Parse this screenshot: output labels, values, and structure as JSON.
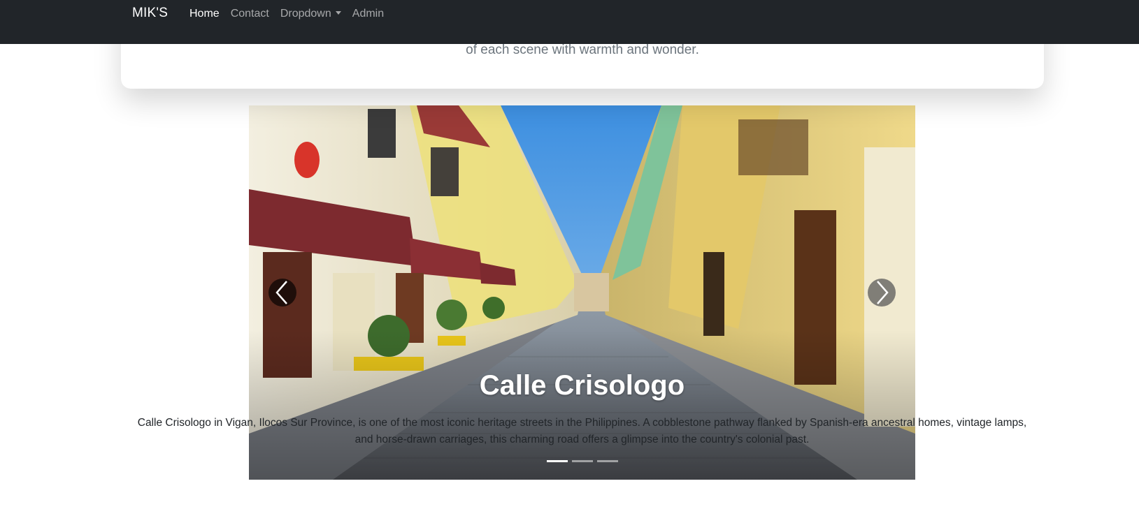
{
  "navbar": {
    "brand": "MIK'S",
    "links": [
      {
        "label": "Home"
      },
      {
        "label": "Contact"
      },
      {
        "label": "Dropdown"
      },
      {
        "label": "Admin"
      }
    ]
  },
  "hero": {
    "subtitle_fragment": "of each scene with warmth and wonder."
  },
  "carousel": {
    "slide": {
      "title": "Calle Crisologo",
      "description": "Calle Crisologo in Vigan, Ilocos Sur Province, is one of the most iconic heritage streets in the Philippines. A cobblestone pathway flanked by Spanish-era ancestral homes, vintage lamps, and horse-drawn carriages, this charming road offers a glimpse into the country's colonial past."
    },
    "indicator_count": 3,
    "active_indicator": 1,
    "prev_icon": "chevron-left-icon",
    "next_icon": "chevron-right-icon"
  },
  "colors": {
    "navbar_bg": "#212529",
    "sky": "#4f9fe6",
    "awning": "#7d2a2f",
    "wall_yellow": "#ead27a"
  }
}
